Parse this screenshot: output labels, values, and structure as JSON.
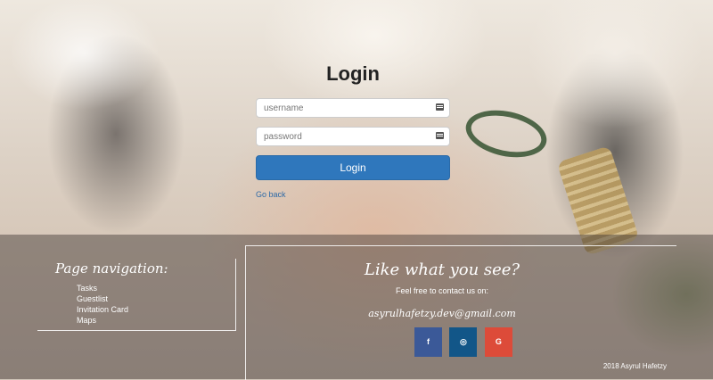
{
  "login": {
    "title": "Login",
    "username_placeholder": "username",
    "password_placeholder": "password",
    "button_label": "Login",
    "back_link": "Go back"
  },
  "footer": {
    "nav": {
      "title": "Page navigation:",
      "items": [
        "Tasks",
        "Guestlist",
        "Invitation Card",
        "Maps"
      ]
    },
    "contact": {
      "title": "Like what you see?",
      "subtitle": "Feel free to contact us on:",
      "email": "asyrulhafetzy.dev@gmail.com",
      "social": [
        {
          "label": "f",
          "icon": "facebook-icon",
          "color": "#3b5998"
        },
        {
          "label": "◎",
          "icon": "instagram-icon",
          "color": "#125688"
        },
        {
          "label": "G",
          "icon": "google-plus-icon",
          "color": "#dd4b39"
        }
      ]
    },
    "copyright": "2018 Asyrul Hafetzy"
  },
  "colors": {
    "primary": "#2f77bc",
    "link": "#2f6aa6"
  }
}
